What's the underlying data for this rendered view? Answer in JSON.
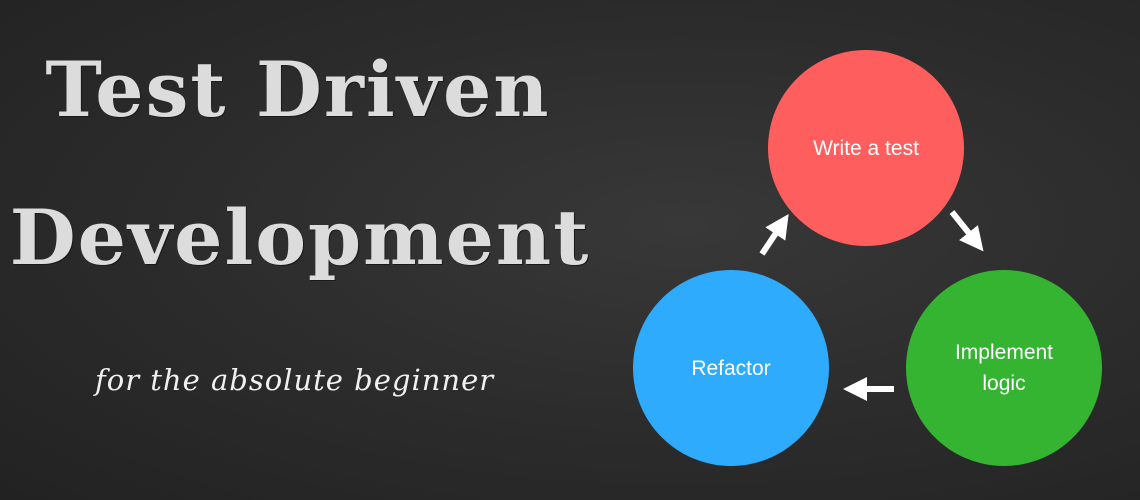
{
  "title": {
    "line1": "Test Driven",
    "line2": "Development",
    "subtitle": "for the absolute beginner"
  },
  "cycle": {
    "steps": [
      {
        "label": "Write a test",
        "color": "#fe5f5e"
      },
      {
        "label": "Implement logic",
        "color": "#34b431"
      },
      {
        "label": "Refactor",
        "color": "#2eabfd"
      }
    ],
    "arrow_color": "#ffffff"
  },
  "colors": {
    "background": "#2d2d2d",
    "title_text": "#dcdcdc"
  }
}
